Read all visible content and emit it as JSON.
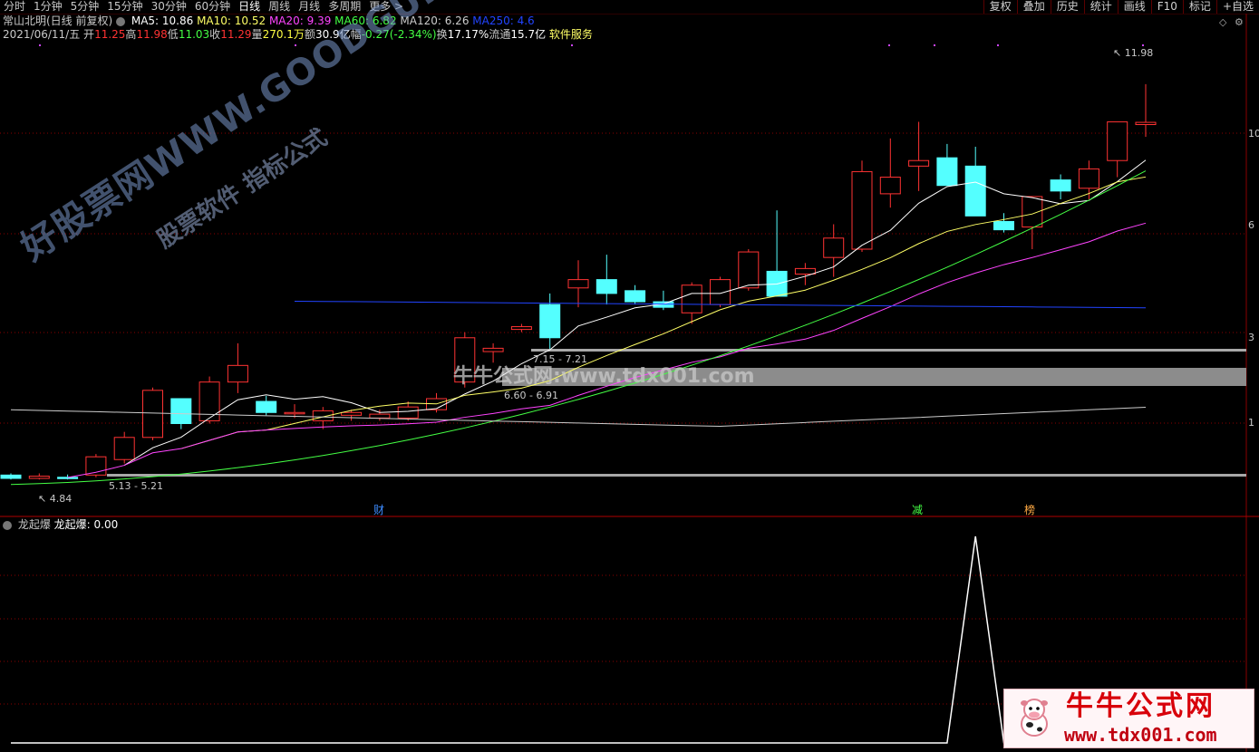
{
  "toolbar": {
    "periods": [
      "分时",
      "1分钟",
      "5分钟",
      "15分钟",
      "30分钟",
      "60分钟",
      "日线",
      "周线",
      "月线",
      "多周期",
      "更多 >"
    ],
    "active_period": "日线",
    "right_buttons": [
      "复权",
      "叠加",
      "历史",
      "统计",
      "画线",
      "F10",
      "标记",
      "+自选"
    ]
  },
  "header": {
    "stock_name": "常山北明(日线 前复权)",
    "ma": [
      {
        "label": "MA5: 10.86",
        "color": "#ffffff"
      },
      {
        "label": "MA10: 10.52",
        "color": "#ffff66"
      },
      {
        "label": "MA20: 9.39",
        "color": "#ff44ff"
      },
      {
        "label": "MA60: 6.82",
        "color": "#44ff44"
      },
      {
        "label": "MA120: 6.26",
        "color": "#cccccc"
      },
      {
        "label": "MA250: 4.6",
        "color": "#2244ff"
      }
    ],
    "date": "2021/06/11/五",
    "quote": [
      {
        "label": "开",
        "value": "11.25",
        "color": "#ff3333"
      },
      {
        "label": "高",
        "value": "11.98",
        "color": "#ff3333"
      },
      {
        "label": "低",
        "value": "11.03",
        "color": "#44ff44"
      },
      {
        "label": "收",
        "value": "11.29",
        "color": "#ff3333"
      },
      {
        "label": "量",
        "value": "270.1万",
        "color": "#ffff44"
      },
      {
        "label": "额",
        "value": "30.9亿",
        "color": "#ffffff"
      },
      {
        "label": "幅",
        "value": "-0.27(-2.34%)",
        "color": "#44ff44"
      },
      {
        "label": "换",
        "value": "17.17%",
        "color": "#ffffff"
      },
      {
        "label": "流通",
        "value": "15.7亿",
        "color": "#ffffff"
      }
    ],
    "industry": "软件服务"
  },
  "price_labels": {
    "high": "11.98",
    "low": "4.84",
    "gap1": "7.15 - 7.21",
    "gap2": "6.60 - 6.91",
    "gap3": "5.13 - 5.21"
  },
  "y_axis_labels": [
    "10",
    "6",
    "3",
    "1"
  ],
  "event_markers": [
    {
      "text": "财",
      "color": "#3d8cff"
    },
    {
      "text": "减",
      "color": "#44ff44"
    },
    {
      "text": "榜",
      "color": "#ffaa44"
    }
  ],
  "indicator": {
    "title": "龙起爆",
    "value_label": "龙起爆: 0.00"
  },
  "watermarks": {
    "diag_main": "好股票网WWW.GOODGUPIAO.COM",
    "diag_sub": "股票软件 指标公式",
    "center": "牛牛公式网:www.tdx001.com",
    "logo_cn": "牛牛公式网",
    "logo_url": "www.tdx001.com"
  },
  "colors": {
    "up": "#ff3333",
    "down": "#54ffff",
    "grid": "#8a0000",
    "ma5": "#ffffff",
    "ma10": "#ffff66",
    "ma20": "#ff44ff",
    "ma60": "#44ff44",
    "ma120": "#cccccc",
    "ma250": "#2244ff"
  },
  "chart_data": {
    "type": "candlestick",
    "series_ohlc": [
      {
        "o": 4.92,
        "h": 4.95,
        "l": 4.84,
        "c": 4.86
      },
      {
        "o": 4.86,
        "h": 4.95,
        "l": 4.84,
        "c": 4.9
      },
      {
        "o": 4.88,
        "h": 4.93,
        "l": 4.84,
        "c": 4.87
      },
      {
        "o": 4.92,
        "h": 5.3,
        "l": 4.88,
        "c": 5.25
      },
      {
        "o": 5.2,
        "h": 5.7,
        "l": 5.13,
        "c": 5.6
      },
      {
        "o": 5.6,
        "h": 6.5,
        "l": 5.55,
        "c": 6.45
      },
      {
        "o": 6.3,
        "h": 6.3,
        "l": 5.75,
        "c": 5.85
      },
      {
        "o": 5.9,
        "h": 6.7,
        "l": 5.85,
        "c": 6.6
      },
      {
        "o": 6.6,
        "h": 7.3,
        "l": 6.4,
        "c": 6.9
      },
      {
        "o": 6.25,
        "h": 6.35,
        "l": 6.0,
        "c": 6.05
      },
      {
        "o": 6.05,
        "h": 6.2,
        "l": 5.95,
        "c": 6.05
      },
      {
        "o": 5.9,
        "h": 6.15,
        "l": 5.75,
        "c": 6.08
      },
      {
        "o": 6.0,
        "h": 6.1,
        "l": 5.9,
        "c": 6.05
      },
      {
        "o": 5.95,
        "h": 6.1,
        "l": 5.9,
        "c": 6.02
      },
      {
        "o": 5.95,
        "h": 6.25,
        "l": 5.9,
        "c": 6.15
      },
      {
        "o": 6.1,
        "h": 6.4,
        "l": 6.05,
        "c": 6.3
      },
      {
        "o": 6.6,
        "h": 7.5,
        "l": 6.5,
        "c": 7.4
      },
      {
        "o": 7.15,
        "h": 7.3,
        "l": 6.95,
        "c": 7.21
      },
      {
        "o": 7.55,
        "h": 7.65,
        "l": 7.5,
        "c": 7.6
      },
      {
        "o": 8.0,
        "h": 8.2,
        "l": 7.2,
        "c": 7.4
      },
      {
        "o": 8.3,
        "h": 8.8,
        "l": 7.95,
        "c": 8.45
      },
      {
        "o": 8.45,
        "h": 8.9,
        "l": 8.0,
        "c": 8.2
      },
      {
        "o": 8.25,
        "h": 8.35,
        "l": 8.0,
        "c": 8.05
      },
      {
        "o": 8.05,
        "h": 8.25,
        "l": 7.9,
        "c": 7.95
      },
      {
        "o": 7.85,
        "h": 8.4,
        "l": 7.65,
        "c": 8.35
      },
      {
        "o": 8.0,
        "h": 8.5,
        "l": 7.95,
        "c": 8.45
      },
      {
        "o": 8.3,
        "h": 9.0,
        "l": 8.25,
        "c": 8.95
      },
      {
        "o": 8.6,
        "h": 9.7,
        "l": 8.55,
        "c": 8.15
      },
      {
        "o": 8.55,
        "h": 8.75,
        "l": 8.35,
        "c": 8.65
      },
      {
        "o": 8.85,
        "h": 9.45,
        "l": 8.5,
        "c": 9.2
      },
      {
        "o": 9.0,
        "h": 10.6,
        "l": 8.95,
        "c": 10.4
      },
      {
        "o": 10.0,
        "h": 11.0,
        "l": 9.75,
        "c": 10.3
      },
      {
        "o": 10.5,
        "h": 11.3,
        "l": 10.05,
        "c": 10.6
      },
      {
        "o": 10.65,
        "h": 10.9,
        "l": 10.3,
        "c": 10.15
      },
      {
        "o": 10.5,
        "h": 10.85,
        "l": 10.0,
        "c": 9.6
      },
      {
        "o": 9.5,
        "h": 9.65,
        "l": 9.3,
        "c": 9.35
      },
      {
        "o": 9.4,
        "h": 9.85,
        "l": 9.0,
        "c": 9.95
      },
      {
        "o": 10.25,
        "h": 10.35,
        "l": 9.9,
        "c": 10.05
      },
      {
        "o": 10.1,
        "h": 10.6,
        "l": 9.9,
        "c": 10.45
      },
      {
        "o": 10.6,
        "h": 11.2,
        "l": 10.3,
        "c": 11.3
      },
      {
        "o": 11.25,
        "h": 11.98,
        "l": 11.03,
        "c": 11.29
      }
    ],
    "indicator_values": [
      0,
      0,
      0,
      0,
      0,
      0,
      0,
      0,
      0,
      0,
      0,
      0,
      0,
      0,
      0,
      0,
      0,
      0,
      0,
      0,
      0,
      0,
      0,
      0,
      0,
      0,
      0,
      0,
      0,
      0,
      0,
      0,
      0,
      0,
      1,
      0,
      0,
      0,
      0,
      0,
      0
    ]
  }
}
